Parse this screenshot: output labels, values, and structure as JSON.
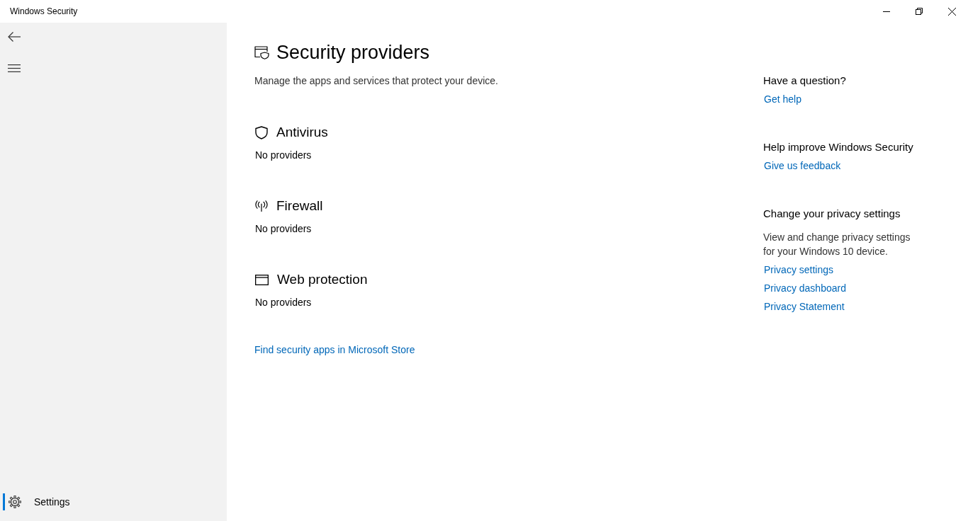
{
  "window": {
    "title": "Windows Security"
  },
  "sidebar": {
    "items": [
      {
        "label": "Settings",
        "selected": true
      }
    ]
  },
  "page": {
    "title": "Security providers",
    "description": "Manage the apps and services that protect your device.",
    "sections": [
      {
        "kind": "antivirus",
        "title": "Antivirus",
        "status": "No providers"
      },
      {
        "kind": "firewall",
        "title": "Firewall",
        "status": "No providers"
      },
      {
        "kind": "web",
        "title": "Web protection",
        "status": "No providers"
      }
    ],
    "store_link": "Find security apps in Microsoft Store"
  },
  "aside": {
    "groups": [
      {
        "heading": "Have a question?",
        "links": [
          "Get help"
        ]
      },
      {
        "heading": "Help improve Windows Security",
        "links": [
          "Give us feedback"
        ]
      },
      {
        "heading": "Change your privacy settings",
        "text": "View and change privacy settings for your Windows 10 device.",
        "links": [
          "Privacy settings",
          "Privacy dashboard",
          "Privacy Statement"
        ]
      }
    ]
  }
}
